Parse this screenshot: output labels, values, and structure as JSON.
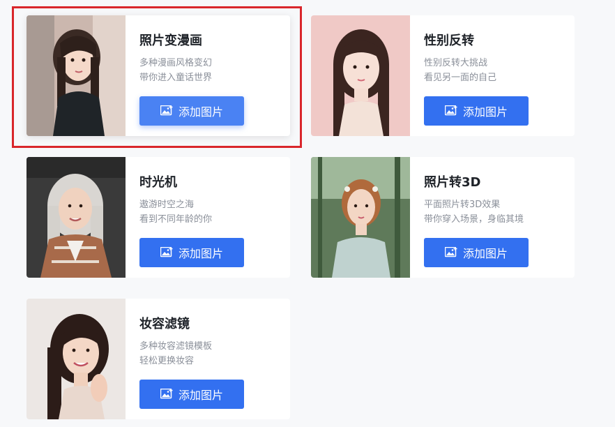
{
  "colors": {
    "page_bg": "#f7f8fa",
    "button_blue": "#3370f0",
    "title_text": "#1f2329",
    "desc_text": "#8a8f99",
    "selection_red": "#d9262b"
  },
  "cards": [
    {
      "title": "照片变漫画",
      "desc_line1": "多种漫画风格变幻",
      "desc_line2": "带你进入童话世界",
      "button_label": "添加图片",
      "button_icon": "image-add-icon",
      "selected": true
    },
    {
      "title": "性别反转",
      "desc_line1": "性别反转大挑战",
      "desc_line2": "看见另一面的自己",
      "button_label": "添加图片",
      "button_icon": "image-add-icon",
      "selected": false
    },
    {
      "title": "时光机",
      "desc_line1": "遨游时空之海",
      "desc_line2": "看到不同年龄的你",
      "button_label": "添加图片",
      "button_icon": "image-add-icon",
      "selected": false
    },
    {
      "title": "照片转3D",
      "desc_line1": "平面照片转3D效果",
      "desc_line2": "带你穿入场景，身临其境",
      "button_label": "添加图片",
      "button_icon": "image-add-icon",
      "selected": false
    },
    {
      "title": "妆容滤镜",
      "desc_line1": "多种妆容滤镜模板",
      "desc_line2": "轻松更换妆容",
      "button_label": "添加图片",
      "button_icon": "image-add-icon",
      "selected": false
    }
  ]
}
